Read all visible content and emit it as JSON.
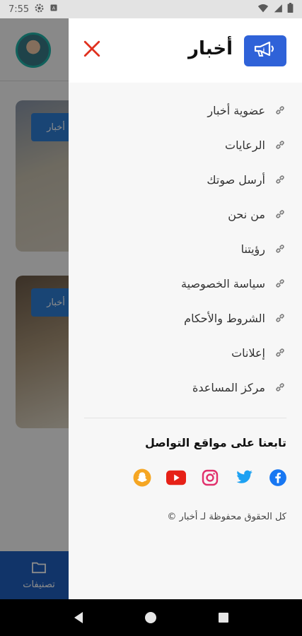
{
  "status_bar": {
    "time": "7:55"
  },
  "background": {
    "chip_label": "أخبار",
    "bottom_tab_label": "تصنيفات"
  },
  "drawer": {
    "title": "أخبار",
    "menu_items": [
      {
        "label": "عضوية أخبار"
      },
      {
        "label": "الرعايات"
      },
      {
        "label": "أرسل صوتك"
      },
      {
        "label": "من نحن"
      },
      {
        "label": "رؤيتنا"
      },
      {
        "label": "سياسة الخصوصية"
      },
      {
        "label": "الشروط والأحكام"
      },
      {
        "label": "إعلانات"
      },
      {
        "label": "مركز المساعدة"
      }
    ],
    "follow_title": "تابعنا على مواقع التواصل",
    "social": [
      "facebook-icon",
      "twitter-icon",
      "instagram-icon",
      "youtube-icon",
      "snapchat-icon"
    ],
    "copyright": "كل الحقوق محفوظة لـ أخبار ©"
  },
  "colors": {
    "accent": "#2f62d8",
    "close": "#e0301e",
    "facebook": "#1877f2",
    "twitter": "#1da1f2",
    "instagram": "#e1306c",
    "youtube": "#e62117",
    "snapchat": "#f5a623"
  }
}
